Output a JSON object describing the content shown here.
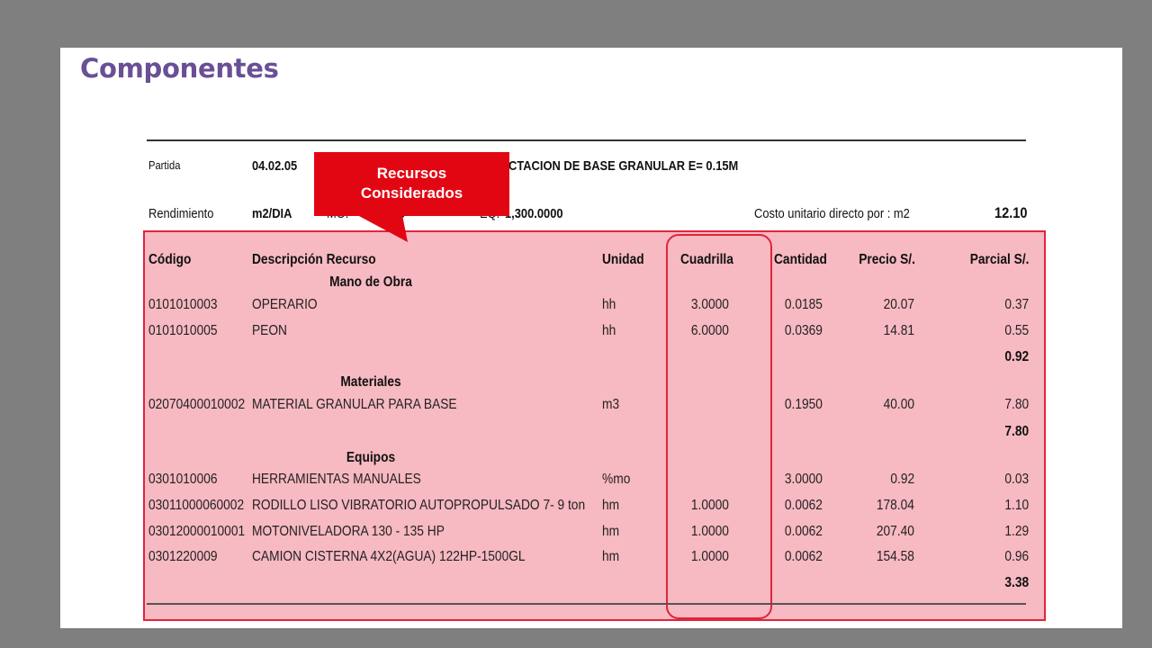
{
  "slide_title": "Componentes",
  "partida": {
    "label": "Partida",
    "code": "04.02.05",
    "description": "CTACION DE BASE GRANULAR E= 0.15M"
  },
  "rendimiento": {
    "label": "Rendimiento",
    "unit": "m2/DIA",
    "mo_partial": "MO.",
    "mo_value_partial": "0",
    "eq_partial": "EQ.",
    "eq_value": "1,300.0000",
    "costo_label": "Costo unitario directo por : m2",
    "costo_value": "12.10"
  },
  "callout": {
    "line1": "Recursos",
    "line2": "Considerados",
    "color": "#e20613"
  },
  "table": {
    "headers": {
      "codigo": "Código",
      "descripcion": "Descripción Recurso",
      "unidad": "Unidad",
      "cuadrilla": "Cuadrilla",
      "cantidad": "Cantidad",
      "precio": "Precio S/.",
      "parcial": "Parcial S/."
    },
    "sections": [
      {
        "title": "Mano de Obra",
        "rows": [
          {
            "codigo": "0101010003",
            "descripcion": "OPERARIO",
            "unidad": "hh",
            "cuadrilla": "3.0000",
            "cantidad": "0.0185",
            "precio": "20.07",
            "parcial": "0.37"
          },
          {
            "codigo": "0101010005",
            "descripcion": "PEON",
            "unidad": "hh",
            "cuadrilla": "6.0000",
            "cantidad": "0.0369",
            "precio": "14.81",
            "parcial": "0.55"
          }
        ],
        "subtotal": "0.92"
      },
      {
        "title": "Materiales",
        "rows": [
          {
            "codigo": "02070400010002",
            "descripcion": "MATERIAL GRANULAR PARA BASE",
            "unidad": "m3",
            "cuadrilla": "",
            "cantidad": "0.1950",
            "precio": "40.00",
            "parcial": "7.80"
          }
        ],
        "subtotal": "7.80"
      },
      {
        "title": "Equipos",
        "rows": [
          {
            "codigo": "0301010006",
            "descripcion": "HERRAMIENTAS MANUALES",
            "unidad": "%mo",
            "cuadrilla": "",
            "cantidad": "3.0000",
            "precio": "0.92",
            "parcial": "0.03"
          },
          {
            "codigo": "03011000060002",
            "descripcion": "RODILLO LISO VIBRATORIO AUTOPROPULSADO 7- 9   ton",
            "unidad": "hm",
            "cuadrilla": "1.0000",
            "cantidad": "0.0062",
            "precio": "178.04",
            "parcial": "1.10"
          },
          {
            "codigo": "03012000010001",
            "descripcion": "MOTONIVELADORA 130 - 135 HP",
            "unidad": "hm",
            "cuadrilla": "1.0000",
            "cantidad": "0.0062",
            "precio": "207.40",
            "parcial": "1.29"
          },
          {
            "codigo": "0301220009",
            "descripcion": "CAMION CISTERNA 4X2(AGUA) 122HP-1500GL",
            "unidad": "hm",
            "cuadrilla": "1.0000",
            "cantidad": "0.0062",
            "precio": "154.58",
            "parcial": "0.96"
          }
        ],
        "subtotal": "3.38"
      }
    ]
  },
  "colors": {
    "background": "#7f7f7f",
    "title": "#6a4f97",
    "highlight_fill": "#f7b9c2",
    "highlight_border": "#e0243b"
  }
}
